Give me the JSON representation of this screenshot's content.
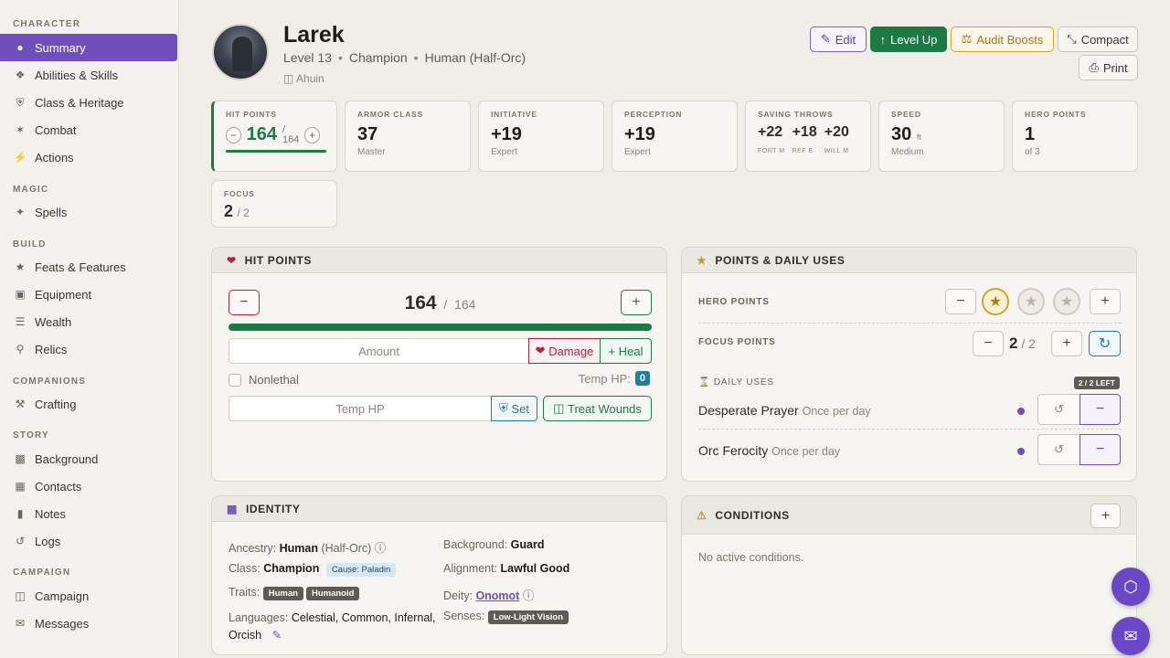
{
  "sidebar": {
    "sections": [
      "CHARACTER",
      "MAGIC",
      "BUILD",
      "COMPANIONS",
      "STORY",
      "CAMPAIGN"
    ],
    "items": [
      {
        "label": "Summary",
        "icon": "person-icon"
      },
      {
        "label": "Abilities & Skills",
        "icon": "dice-icon"
      },
      {
        "label": "Class & Heritage",
        "icon": "shield-icon"
      },
      {
        "label": "Combat",
        "icon": "combat-icon"
      },
      {
        "label": "Actions",
        "icon": "bolt-icon"
      },
      {
        "label": "Spells",
        "icon": "wand-icon"
      },
      {
        "label": "Feats & Features",
        "icon": "star-icon"
      },
      {
        "label": "Equipment",
        "icon": "equipment-icon"
      },
      {
        "label": "Wealth",
        "icon": "coins-icon"
      },
      {
        "label": "Relics",
        "icon": "relic-icon"
      },
      {
        "label": "Crafting",
        "icon": "hammer-icon"
      },
      {
        "label": "Background",
        "icon": "book-icon"
      },
      {
        "label": "Contacts",
        "icon": "contacts-icon"
      },
      {
        "label": "Notes",
        "icon": "notes-icon"
      },
      {
        "label": "Logs",
        "icon": "history-icon"
      },
      {
        "label": "Campaign",
        "icon": "map-icon"
      },
      {
        "label": "Messages",
        "icon": "chat-icon"
      }
    ]
  },
  "character": {
    "name": "Larek",
    "level": "Level 13",
    "class": "Champion",
    "ancestry": "Human (Half-Orc)",
    "campaign": "Ahuin"
  },
  "header_buttons": {
    "edit": "Edit",
    "level_up": "Level Up",
    "audit": "Audit Boosts",
    "compact": "Compact",
    "print": "Print"
  },
  "stats": {
    "hp": {
      "label": "HIT POINTS",
      "current": "164",
      "max": "164"
    },
    "ac": {
      "label": "ARMOR CLASS",
      "value": "37",
      "sub": "Master"
    },
    "initiative": {
      "label": "INITIATIVE",
      "value": "+19",
      "sub": "Expert"
    },
    "perception": {
      "label": "PERCEPTION",
      "value": "+19",
      "sub": "Expert"
    },
    "saves": {
      "label": "SAVING THROWS",
      "fort": "+22",
      "fort_l": "FORT M",
      "ref": "+18",
      "ref_l": "REF E",
      "will": "+20",
      "will_l": "WILL M"
    },
    "speed": {
      "label": "SPEED",
      "value": "30",
      "unit": "ft",
      "sub": "Medium"
    },
    "hero": {
      "label": "HERO POINTS",
      "value": "1",
      "sub": "of 3"
    },
    "focus": {
      "label": "FOCUS",
      "value": "2",
      "max": "/ 2"
    }
  },
  "hp_panel": {
    "title": "HIT POINTS",
    "current": "164",
    "max": "164",
    "fill": 1.0,
    "amount_placeholder": "Amount",
    "damage": "Damage",
    "heal": "Heal",
    "nonlethal": "Nonlethal",
    "temp_label": "Temp HP:",
    "temp_value": "0",
    "temp_placeholder": "Temp HP",
    "set": "Set",
    "treat": "Treat Wounds"
  },
  "points_panel": {
    "title": "POINTS & DAILY USES",
    "hero_label": "HERO POINTS",
    "focus_label": "FOCUS POINTS",
    "focus_cur": "2",
    "focus_max": "2",
    "daily_label": "DAILY USES",
    "daily_badge": "2 / 2 LEFT",
    "uses": [
      {
        "name": "Desperate Prayer",
        "freq": "Once per day"
      },
      {
        "name": "Orc Ferocity",
        "freq": "Once per day"
      }
    ]
  },
  "identity": {
    "title": "IDENTITY",
    "ancestry_k": "Ancestry:",
    "ancestry_v": "Human",
    "ancestry_x": "(Half-Orc)",
    "class_k": "Class:",
    "class_v": "Champion",
    "cause": "Cause: Paladin",
    "traits_k": "Traits:",
    "traits": [
      "Human",
      "Humanoid"
    ],
    "lang_k": "Languages:",
    "lang_v1": "Celestial, Common, Infernal,",
    "lang_v2": "Orcish",
    "bg_k": "Background:",
    "bg_v": "Guard",
    "align_k": "Alignment:",
    "align_v": "Lawful Good",
    "deity_k": "Deity:",
    "deity_v": "Onomot",
    "senses_k": "Senses:",
    "senses_v": "Low-Light Vision"
  },
  "conditions": {
    "title": "CONDITIONS",
    "empty": "No active conditions."
  },
  "colors": {
    "accent": "#6f4fbd",
    "green": "#1d7a45",
    "red": "#b3263a",
    "gold": "#d2a42e",
    "teal": "#1f7fa3"
  }
}
